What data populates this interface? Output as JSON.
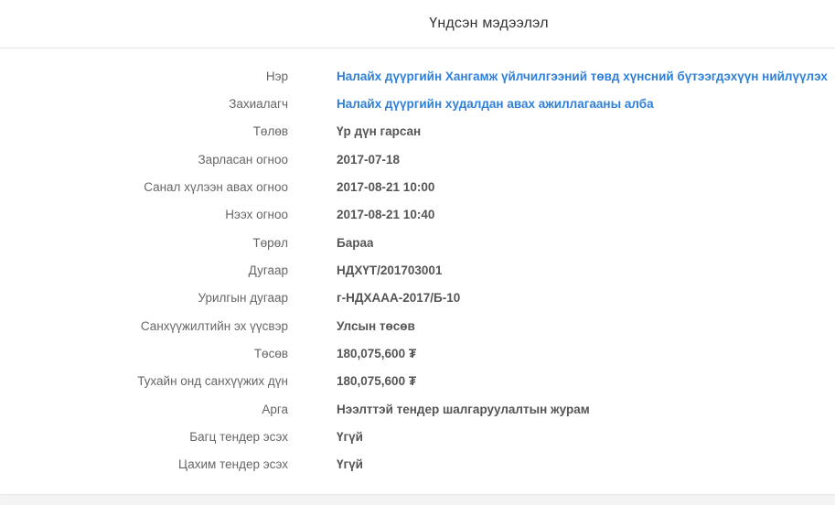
{
  "panel": {
    "title": "Үндсэн мэдээлэл"
  },
  "colors": {
    "link": "#2f80d9",
    "label": "#666666",
    "value": "#555555"
  },
  "rows": [
    {
      "label": "Нэр",
      "value": "Налайх дүүргийн Хангамж үйлчилгээний төвд хүнсний бүтээгдэхүүн нийлүүлэх"
    },
    {
      "label": "Захиалагч",
      "value": "Налайх дүүргийн худалдан авах ажиллагааны алба"
    },
    {
      "label": "Төлөв",
      "value": "Үр дүн гарсан"
    },
    {
      "label": "Зарласан огноо",
      "value": "2017-07-18"
    },
    {
      "label": "Санал хүлээн авах огноо",
      "value": "2017-08-21 10:00"
    },
    {
      "label": "Нээх огноо",
      "value": "2017-08-21 10:40"
    },
    {
      "label": "Төрөл",
      "value": "Бараа"
    },
    {
      "label": "Дугаар",
      "value": "НДХҮТ/201703001"
    },
    {
      "label": "Урилгын дугаар",
      "value": "г-НДХААА-2017/Б-10"
    },
    {
      "label": "Санхүүжилтийн эх үүсвэр",
      "value": "Улсын төсөв"
    },
    {
      "label": "Төсөв",
      "value": "180,075,600 ₮"
    },
    {
      "label": "Тухайн онд санхүүжих дүн",
      "value": "180,075,600 ₮"
    },
    {
      "label": "Арга",
      "value": "Нээлттэй тендер шалгаруулалтын журам"
    },
    {
      "label": "Багц тендер эсэх",
      "value": "Үгүй"
    },
    {
      "label": "Цахим тендер эсэх",
      "value": "Үгүй"
    }
  ]
}
